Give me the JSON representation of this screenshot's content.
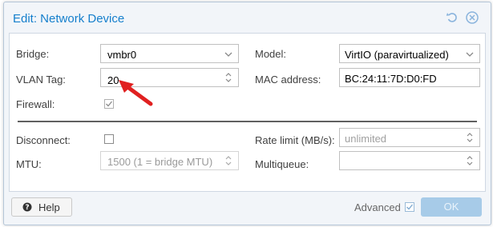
{
  "dialog": {
    "title": "Edit: Network Device",
    "reset_icon": "reset-icon",
    "close_icon": "close-icon"
  },
  "form": {
    "bridge": {
      "label": "Bridge:",
      "value": "vmbr0"
    },
    "vlan_tag": {
      "label": "VLAN Tag:",
      "value": "20"
    },
    "firewall": {
      "label": "Firewall:",
      "checked": true
    },
    "model": {
      "label": "Model:",
      "value": "VirtIO (paravirtualized)"
    },
    "mac_address": {
      "label": "MAC address:",
      "value": "BC:24:11:7D:D0:FD"
    },
    "disconnect": {
      "label": "Disconnect:",
      "checked": false
    },
    "mtu": {
      "label": "MTU:",
      "value": "1500 (1 = bridge MTU)"
    },
    "rate_limit": {
      "label": "Rate limit (MB/s):",
      "placeholder": "unlimited"
    },
    "multiqueue": {
      "label": "Multiqueue:",
      "value": ""
    }
  },
  "footer": {
    "help_label": "Help",
    "advanced_label": "Advanced",
    "advanced_checked": true,
    "ok_label": "OK"
  },
  "annotation": {
    "type": "red-arrow",
    "color": "#e02020"
  },
  "colors": {
    "accent": "#157fcc",
    "ok_disabled": "#a7cbe8"
  }
}
